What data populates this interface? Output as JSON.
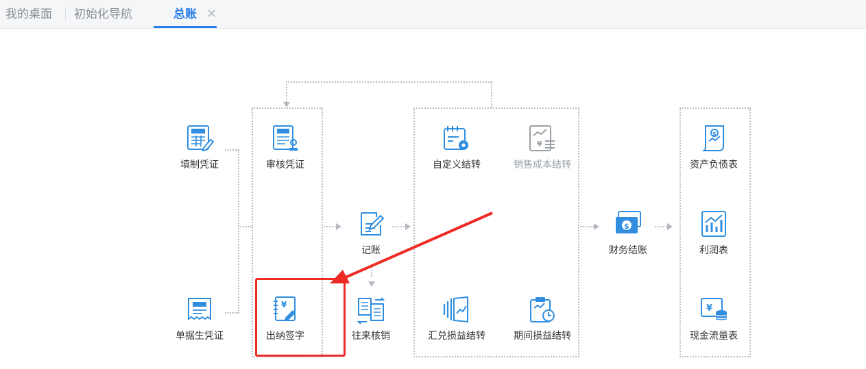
{
  "tabs": [
    {
      "label": "我的桌面",
      "active": false
    },
    {
      "label": "初始化导航",
      "active": false
    },
    {
      "label": "总账",
      "active": true
    }
  ],
  "tab_close_glyph": "✕",
  "colors": {
    "accent": "#2b7fe8",
    "icon_blue": "#2f8ee0",
    "icon_gray": "#9aa0a6",
    "highlight_red": "#ee2a24"
  },
  "nodes": {
    "fill_voucher": {
      "label": "填制凭证",
      "icon": "voucher-fill-icon"
    },
    "single_doc_voucher": {
      "label": "单据生凭证",
      "icon": "voucher-generate-icon"
    },
    "audit_voucher": {
      "label": "审核凭证",
      "icon": "voucher-audit-icon"
    },
    "cashier_sign": {
      "label": "出纳签字",
      "icon": "cashier-sign-icon"
    },
    "bookkeeping": {
      "label": "记账",
      "icon": "bookkeeping-icon"
    },
    "reconcile": {
      "label": "往来核销",
      "icon": "reconcile-icon"
    },
    "custom_transfer": {
      "label": "自定义结转",
      "icon": "custom-transfer-icon"
    },
    "sales_cost_transfer": {
      "label": "销售成本结转",
      "icon": "sales-cost-transfer-icon",
      "disabled": true
    },
    "fx_transfer": {
      "label": "汇兑损益结转",
      "icon": "fx-transfer-icon"
    },
    "period_transfer": {
      "label": "期间损益结转",
      "icon": "period-transfer-icon"
    },
    "finance_close": {
      "label": "财务结账",
      "icon": "finance-close-icon"
    },
    "balance_sheet": {
      "label": "资产负债表",
      "icon": "balance-sheet-icon"
    },
    "income_statement": {
      "label": "利润表",
      "icon": "income-statement-icon"
    },
    "cash_flow": {
      "label": "现金流量表",
      "icon": "cash-flow-icon"
    }
  }
}
